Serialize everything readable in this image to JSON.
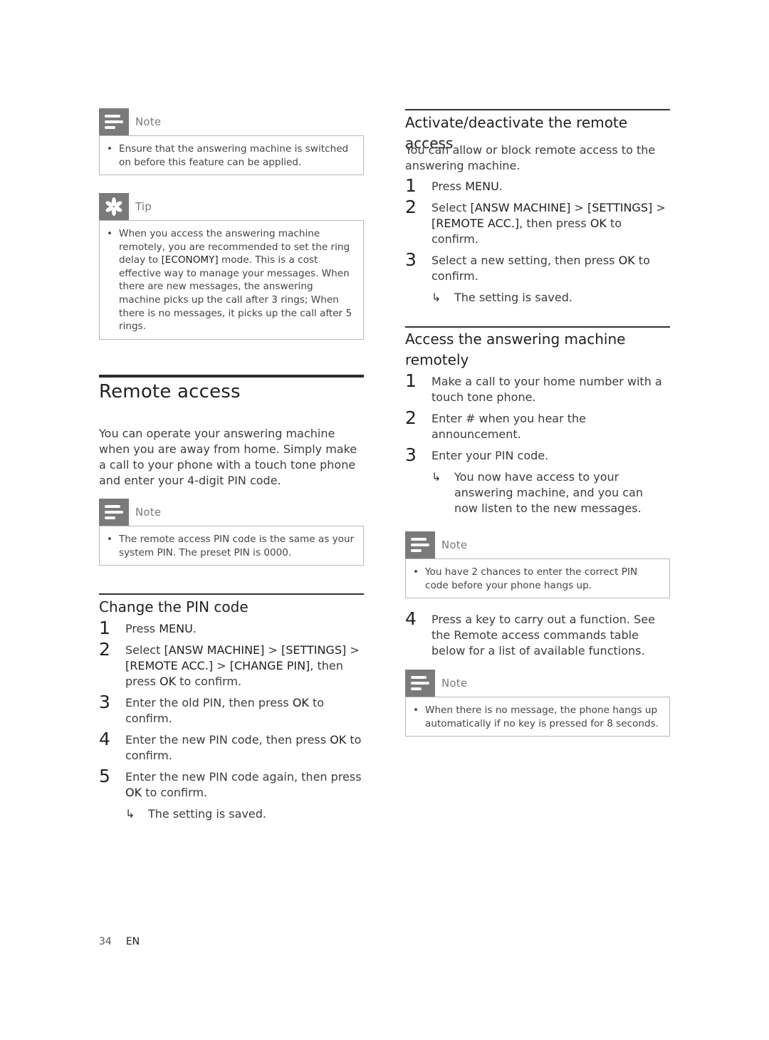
{
  "page": {
    "number": "34",
    "lang": "EN"
  },
  "left": {
    "note1": {
      "icon": "note-icon",
      "label": "Note",
      "text": "Ensure that the answering machine is switched on before this feature can be applied."
    },
    "tip": {
      "icon": "tip-icon",
      "label": "Tip",
      "text_before": "When you access the answering machine remotely, you are recommended to set the ring delay to ",
      "text_bold": "[ECONOMY]",
      "text_after": " mode. This is a cost effective way to manage your messages. When there are new messages, the answering machine picks up the call after 3 rings; When there is no messages, it picks up the call after 5 rings."
    },
    "section_title": "Remote access",
    "intro": "You can operate your answering machine when you are away from home. Simply make a call to your phone with a touch tone phone and enter your 4-digit PIN code.",
    "note2": {
      "icon": "note-icon",
      "label": "Note",
      "text": "The remote access PIN code is the same as your system PIN. The preset PIN is 0000."
    },
    "change_pin": {
      "title": "Change the PIN code",
      "steps": [
        {
          "num": "1",
          "parts": [
            "Press ",
            "MENU",
            "."
          ]
        },
        {
          "num": "2",
          "parts": [
            "Select ",
            "[ANSW MACHINE]",
            " > ",
            "[SETTINGS]",
            " > ",
            "[REMOTE ACC.]",
            " > ",
            "[CHANGE PIN]",
            ", then press ",
            "OK",
            " to confirm."
          ]
        },
        {
          "num": "3",
          "parts": [
            "Enter the old PIN, then press ",
            "OK",
            " to confirm."
          ]
        },
        {
          "num": "4",
          "parts": [
            "Enter the new PIN code, then press ",
            "OK",
            " to confirm."
          ]
        },
        {
          "num": "5",
          "parts": [
            "Enter the new PIN code again, then press ",
            "OK",
            " to confirm."
          ]
        }
      ],
      "result": "The setting is saved."
    }
  },
  "right": {
    "activate": {
      "title": "Activate/deactivate the remote access",
      "intro": "You can allow or block remote access to the answering machine.",
      "steps": [
        {
          "num": "1",
          "parts": [
            "Press ",
            "MENU",
            "."
          ]
        },
        {
          "num": "2",
          "parts": [
            "Select ",
            "[ANSW MACHINE]",
            " > ",
            "[SETTINGS]",
            " > ",
            "[REMOTE ACC.]",
            ", then press ",
            "OK",
            " to confirm."
          ]
        },
        {
          "num": "3",
          "parts": [
            "Select a new setting, then press ",
            "OK",
            " to confirm."
          ]
        }
      ],
      "result": "The setting is saved."
    },
    "access": {
      "title": "Access the answering machine remotely",
      "steps": [
        {
          "num": "1",
          "parts": [
            "Make a call to your home number with a touch tone phone."
          ]
        },
        {
          "num": "2",
          "parts": [
            "Enter # when you hear the announcement."
          ]
        },
        {
          "num": "3",
          "parts": [
            "Enter your PIN code."
          ]
        }
      ],
      "result": "You now have access to your answering machine, and you can now listen to the new messages.",
      "note": {
        "icon": "note-icon",
        "label": "Note",
        "text": "You have 2 chances to enter the correct PIN code before your phone hangs up."
      },
      "step4": {
        "num": "4",
        "text": "Press a key to carry out a function. See the Remote access commands table below for a list of available functions."
      },
      "note2": {
        "icon": "note-icon",
        "label": "Note",
        "text": "When there is no message, the phone hangs up automatically if no key is pressed for 8 seconds."
      }
    }
  }
}
